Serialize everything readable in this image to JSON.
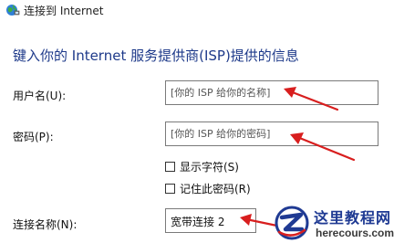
{
  "window": {
    "title": "连接到 Internet",
    "icon": "globe-network-icon"
  },
  "heading": "键入你的 Internet 服务提供商(ISP)提供的信息",
  "form": {
    "username": {
      "label": "用户名(U):",
      "value": "[你的 ISP 给你的名称]"
    },
    "password": {
      "label": "密码(P):",
      "value": "[你的 ISP 给你的密码]"
    },
    "show_chars": {
      "label": "显示字符(S)",
      "checked": false
    },
    "remember_password": {
      "label": "记住此密码(R)",
      "checked": false
    },
    "connection_name": {
      "label": "连接名称(N):",
      "value": "宽带连接 2"
    }
  },
  "annotations": {
    "arrow_color": "#d81e1e"
  },
  "watermark": {
    "title": "这里教程网",
    "url": "herecours.com"
  }
}
